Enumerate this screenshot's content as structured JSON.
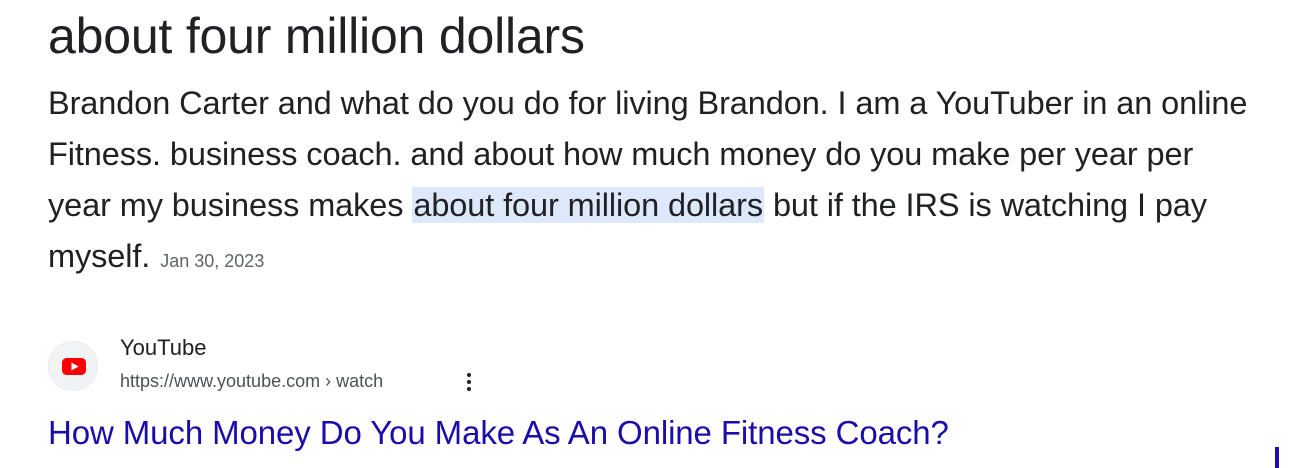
{
  "answer": {
    "heading": "about four million dollars",
    "body_before": "Brandon Carter and what do you do for living Brandon. I am a YouTuber in an online Fitness. business coach. and about how much money do you make per year per year my business makes ",
    "body_highlight": "about four million dollars",
    "body_after": " but if the IRS is watching I pay myself.",
    "date": "Jan 30, 2023"
  },
  "source": {
    "favicon_icon": "youtube-logo-icon",
    "site_name": "YouTube",
    "url": "https://www.youtube.com › watch",
    "more_icon": "more-vert-icon"
  },
  "result": {
    "title": "How Much Money Do You Make As An Online Fitness Coach?"
  },
  "colors": {
    "link": "#1a0dab",
    "highlight": "#dde8fb",
    "youtube_red": "#ff0000"
  }
}
